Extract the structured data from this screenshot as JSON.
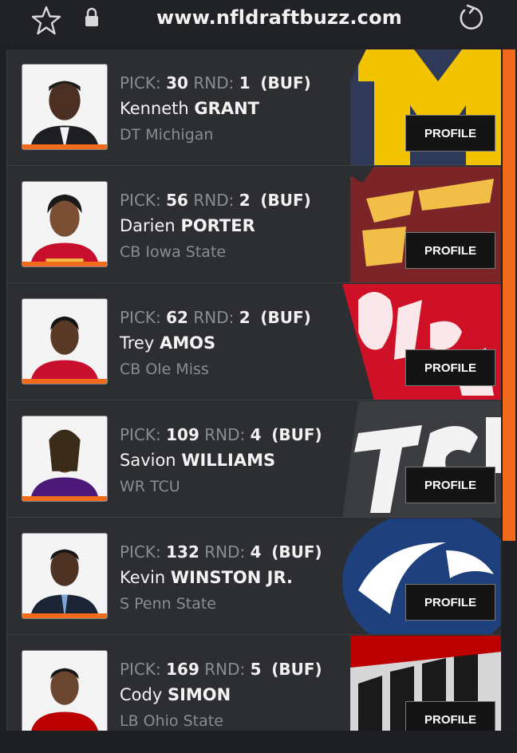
{
  "browser": {
    "url": "www.nfldraftbuzz.com",
    "star_icon": "star-icon",
    "lock_icon": "lock-icon",
    "reload_icon": "reload-icon"
  },
  "labels": {
    "pick": "PICK:",
    "rnd": "RND:",
    "profile": "PROFILE"
  },
  "accent_color": "#f26a1b",
  "picks": [
    {
      "pick": "30",
      "round": "1",
      "team": "(BUF)",
      "first": "Kenneth",
      "last": "GRANT",
      "position": "DT Michigan",
      "logo": "michigan-logo"
    },
    {
      "pick": "56",
      "round": "2",
      "team": "(BUF)",
      "first": "Darien",
      "last": "PORTER",
      "position": "CB Iowa State",
      "logo": "iowa-state-logo"
    },
    {
      "pick": "62",
      "round": "2",
      "team": "(BUF)",
      "first": "Trey",
      "last": "AMOS",
      "position": "CB Ole Miss",
      "logo": "ole-miss-logo"
    },
    {
      "pick": "109",
      "round": "4",
      "team": "(BUF)",
      "first": "Savion",
      "last": "WILLIAMS",
      "position": "WR TCU",
      "logo": "tcu-logo"
    },
    {
      "pick": "132",
      "round": "4",
      "team": "(BUF)",
      "first": "Kevin",
      "last": "WINSTON JR.",
      "position": "S Penn State",
      "logo": "penn-state-logo"
    },
    {
      "pick": "169",
      "round": "5",
      "team": "(BUF)",
      "first": "Cody",
      "last": "SIMON",
      "position": "LB Ohio State",
      "logo": "ohio-state-logo"
    }
  ]
}
